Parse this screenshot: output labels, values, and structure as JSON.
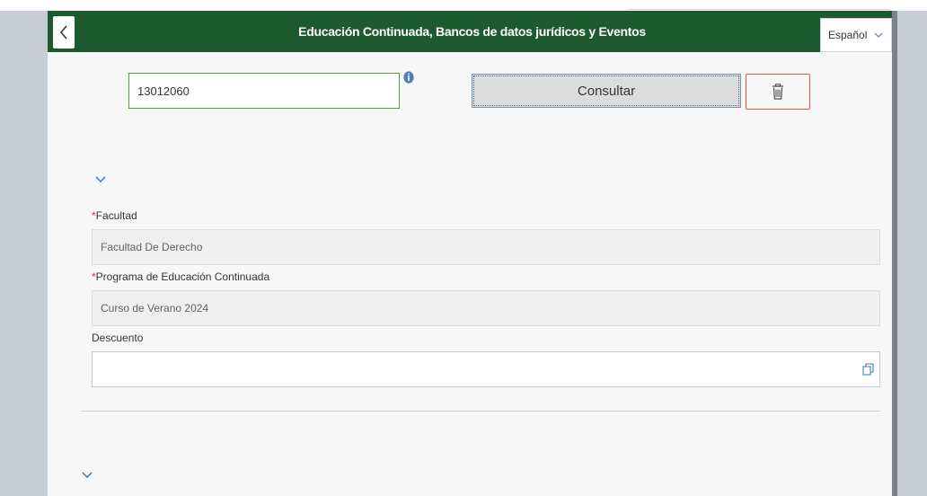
{
  "header": {
    "title": "Educación Continuada, Bancos de datos jurídicos y Eventos",
    "back_icon": "chevron-left-icon",
    "language": {
      "selected": "Español",
      "icon": "chevron-down-icon"
    }
  },
  "query": {
    "id_value": "13012060",
    "info_icon": "info-icon",
    "consult_label": "Consultar",
    "delete_icon": "trash-icon"
  },
  "form": {
    "section_toggle_icon": "chevron-down-icon",
    "faculty": {
      "label": "Facultad",
      "required": true,
      "value": "Facultad De Derecho"
    },
    "program": {
      "label": "Programa de Educación Continuada",
      "required": true,
      "value": "Curso de Verano 2024"
    },
    "discount": {
      "label": "Descuento",
      "value": "",
      "icon": "value-help-icon"
    }
  },
  "colors": {
    "header_bg": "#1e5a30",
    "accent_green": "#5a9a42",
    "delete_red": "#d9534f",
    "link_blue": "#3f74a8"
  }
}
